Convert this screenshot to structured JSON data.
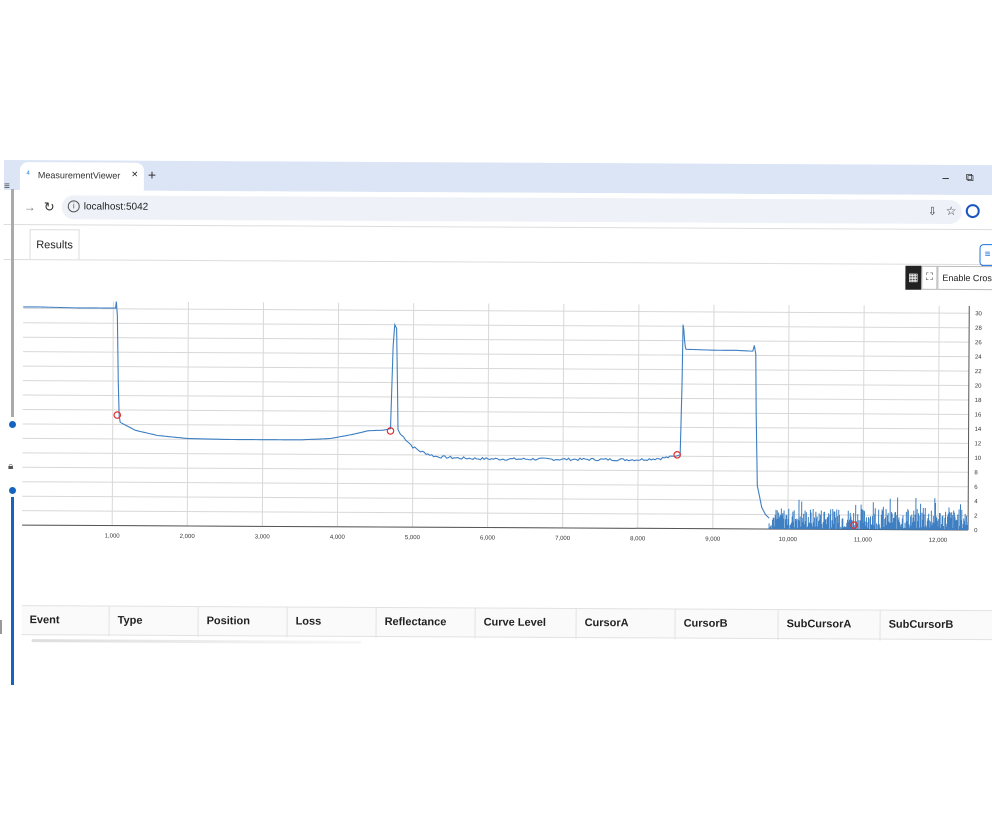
{
  "browser": {
    "tab_title": "MeasurementViewer",
    "tab_close": "×",
    "new_tab": "+",
    "minimize": "−",
    "restore": "⧉",
    "url": "localhost:5042"
  },
  "icons": {
    "app": "app-logo-icon",
    "back": "arrow-forward-icon",
    "reload": "reload-icon",
    "info": "info-icon",
    "install": "install-app-icon",
    "bookmark": "star-icon",
    "profile": "profile-icon",
    "grid": "grid-icon",
    "fullscreen": "fullscreen-icon",
    "menu": "hamburger-menu-icon"
  },
  "page": {
    "results_tab": "Results",
    "menu_glyph": "≡",
    "crosshair_label": "Enable Crossh"
  },
  "table": {
    "columns": [
      "Event",
      "Type",
      "Position",
      "Loss",
      "Reflectance",
      "Curve Level",
      "CursorA",
      "CursorB",
      "SubCursorA",
      "SubCursorB"
    ]
  },
  "colors": {
    "trace": "#3d7fc2",
    "marker": "#e03131",
    "grid": "#d8d8d8",
    "accent": "#1a73e8"
  },
  "chart_data": {
    "type": "line",
    "title": "",
    "xlabel": "",
    "ylabel": "",
    "xlim": [
      -200,
      12400
    ],
    "ylim": [
      0,
      31
    ],
    "x_ticks": [
      1000,
      2000,
      3000,
      4000,
      5000,
      6000,
      7000,
      8000,
      9000,
      10000,
      11000,
      12000
    ],
    "x_tick_labels": [
      "1,000",
      "2,000",
      "3,000",
      "4,000",
      "5,000",
      "6,000",
      "7,000",
      "8,000",
      "9,000",
      "10,000",
      "11,000",
      "12,000"
    ],
    "y_ticks": [
      0,
      2,
      4,
      6,
      8,
      10,
      12,
      14,
      16,
      18,
      20,
      22,
      24,
      26,
      28,
      30
    ],
    "y_tick_labels": [
      "0",
      "2",
      "4",
      "6",
      "8",
      "10",
      "12",
      "14",
      "16",
      "18",
      "20",
      "22",
      "24",
      "26",
      "28",
      "30"
    ],
    "y_axis_side": "right",
    "grid": true,
    "series": [
      {
        "x": [
          -200,
          0,
          500,
          1030,
          1040,
          1055,
          1070,
          1085,
          1100,
          1300,
          1600,
          2000,
          2500,
          3000,
          3500,
          3900,
          4200,
          4400,
          4600,
          4700,
          4730,
          4750,
          4775,
          4790,
          4800,
          4830,
          4900,
          5000,
          5100,
          5300,
          5600,
          6000,
          6500,
          7000,
          7500,
          8000,
          8300,
          8500,
          8560,
          8580,
          8590,
          8600,
          8610,
          8620,
          8630,
          8700,
          9000,
          9300,
          9520,
          9540,
          9560,
          9570,
          9590,
          9650,
          9700,
          9750
        ],
        "y": [
          30.2,
          30.2,
          30.1,
          30.1,
          31.0,
          29.0,
          20.0,
          15.2,
          14.3,
          13.2,
          12.5,
          12.1,
          12.0,
          12.0,
          12.0,
          12.2,
          12.8,
          13.3,
          13.4,
          13.6,
          25.0,
          28.0,
          27.5,
          20.0,
          13.5,
          12.9,
          12.2,
          11.1,
          10.5,
          9.8,
          9.6,
          9.5,
          9.5,
          9.5,
          9.5,
          9.5,
          9.7,
          10.0,
          10.2,
          20.0,
          28.2,
          27.5,
          26.2,
          25.2,
          24.8,
          24.8,
          24.7,
          24.7,
          24.6,
          25.4,
          24.2,
          16.0,
          6.0,
          3.0,
          2.0,
          1.5
        ]
      }
    ],
    "noise_floor": {
      "x_range": [
        9750,
        12400
      ],
      "y_range": [
        0,
        4.5
      ]
    },
    "markers": [
      {
        "x": 1060,
        "y": 15.3
      },
      {
        "x": 4700,
        "y": 13.3
      },
      {
        "x": 8520,
        "y": 10.2
      },
      {
        "x": 10880,
        "y": 0.6
      }
    ]
  }
}
